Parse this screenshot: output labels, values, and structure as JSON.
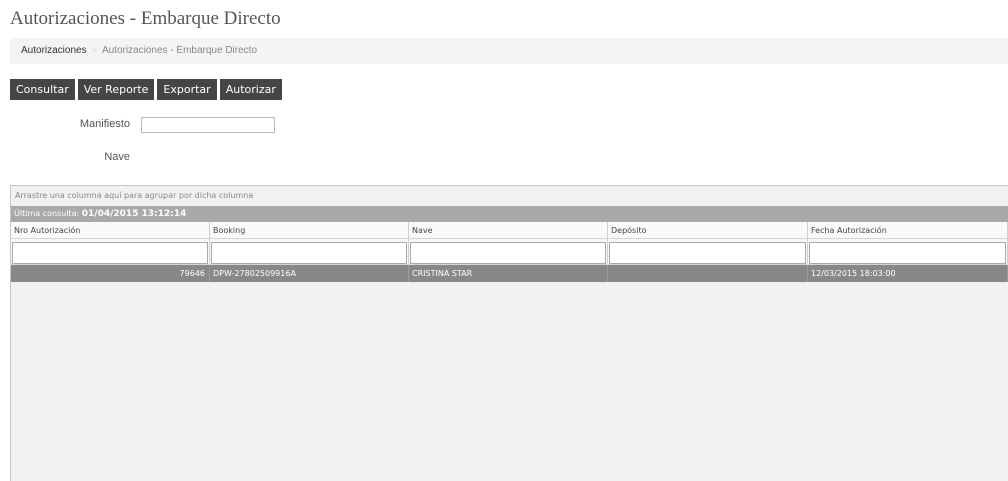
{
  "page": {
    "title": "Autorizaciones - Embarque Directo"
  },
  "breadcrumb": {
    "root": "Autorizaciones",
    "separator": "›",
    "current": "Autorizaciones - Embarque Directo"
  },
  "toolbar": {
    "consultar_label": "Consultar",
    "ver_reporte_label": "Ver Reporte",
    "exportar_label": "Exportar",
    "autorizar_label": "Autorizar"
  },
  "form": {
    "manifiesto_label": "Manifiesto",
    "manifiesto_value": "",
    "nave_label": "Nave"
  },
  "grid": {
    "group_panel_text": "Arrastre una columna aquí para agrupar por dicha columna",
    "last_query_label": "Última consulta:",
    "last_query_value": "01/04/2015 13:12:14",
    "columns": [
      "Nro Autorización",
      "Booking",
      "Nave",
      "Depósito",
      "Fecha Autorización"
    ],
    "rows": [
      {
        "nro_autorizacion": "79646",
        "booking": "DPW-27802509916A",
        "nave": "CRISTINA STAR",
        "deposito": "",
        "fecha_autorizacion": "12/03/2015 18:03:00"
      }
    ]
  },
  "colors": {
    "button_bg": "#454545",
    "status_bar_bg": "#a9a9a9",
    "selected_row_bg": "#888888",
    "grid_bg": "#f1f1f1"
  }
}
